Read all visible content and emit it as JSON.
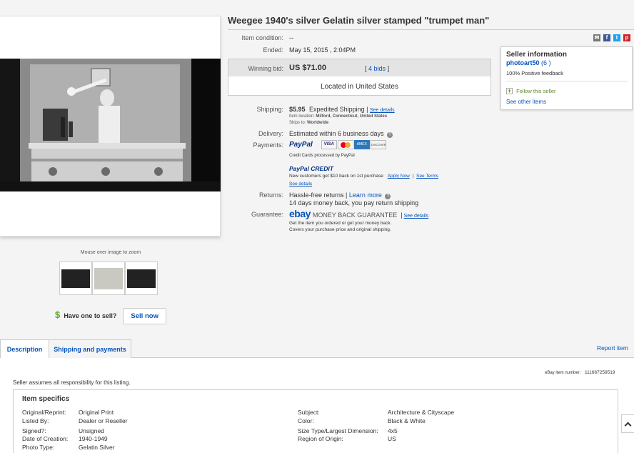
{
  "title": "Weegee 1940's silver Gelatin silver stamped \"trumpet man\"",
  "item": {
    "condition_label": "Item condition:",
    "condition_value": "--",
    "ended_label": "Ended:",
    "ended_value": "May 15, 2015 , 2:04PM",
    "winning_bid_label": "Winning bid:",
    "winning_bid_value": "US $71.00",
    "bids_open": "[",
    "bids_link": "4 bids",
    "bids_close": "]",
    "location": "Located in United States"
  },
  "image": {
    "zoom_hint": "Mouse over image to zoom"
  },
  "sell": {
    "dollar": "$",
    "prompt": "Have one to sell?",
    "button": "Sell now"
  },
  "shipping": {
    "label": "Shipping:",
    "cost": "$5.95",
    "method": "Expedited Shipping",
    "sep": "|",
    "details_link": "See details",
    "location_label": "Item location:",
    "location_value": "Milford, Connecticut, United States",
    "ships_to_label": "Ships to:",
    "ships_to_value": "Worldwide"
  },
  "delivery": {
    "label": "Delivery:",
    "value": "Estimated within 6 business days"
  },
  "payments": {
    "label": "Payments:",
    "paypal": "PayPal",
    "visa": "VISA",
    "amex": "AMEX",
    "discover": "DISCOVER",
    "cc_note": "Credit Cards processed by PayPal",
    "credit_logo": "PayPal CREDIT",
    "credit_offer": "New customers get $10 back on 1st purchase",
    "apply_link": "Apply Now",
    "sep": "|",
    "terms_link": "See Terms",
    "details_link": "See details"
  },
  "returns": {
    "label": "Returns:",
    "value": "Hassle-free returns",
    "sep": "|",
    "learn_link": "Learn more",
    "detail": "14 days money back, you pay return shipping"
  },
  "guarantee": {
    "label": "Guarantee:",
    "ebay_logo": "ebay",
    "mbg": "MONEY BACK GUARANTEE",
    "sep": "|",
    "details_link": "See details",
    "line1": "Get the item you ordered or get your money back.",
    "line2": "Covers your purchase price and original shipping."
  },
  "seller": {
    "heading": "Seller information",
    "name": "photoart50",
    "score": "(6 )",
    "feedback": "100% Positive feedback",
    "follow": "Follow this seller",
    "other_items": "See other items"
  },
  "social_icons": [
    "email-icon",
    "facebook-icon",
    "twitter-icon",
    "pinterest-icon"
  ],
  "tabs": {
    "description": "Description",
    "shipping": "Shipping and payments"
  },
  "report_item": "Report item",
  "item_number_label": "eBay item number:",
  "item_number": "111667259519",
  "responsibility": "Seller assumes all responsibility for this listing.",
  "specifics": {
    "heading": "Item specifics",
    "left": [
      {
        "k": "Original/Reprint:",
        "v": "Original Print"
      },
      {
        "k": "Listed By:",
        "v": "Dealer or Reseller"
      },
      {
        "k": "Signed?:",
        "v": "Unsigned"
      },
      {
        "k": "Date of Creation:",
        "v": "1940-1949"
      },
      {
        "k": "Photo Type:",
        "v": "Gelatin Silver"
      }
    ],
    "right": [
      {
        "k": "Subject:",
        "v": "Architecture & Cityscape"
      },
      {
        "k": "Color:",
        "v": "Black & White"
      },
      {
        "k": "Size Type/Largest Dimension:",
        "v": "4x5"
      },
      {
        "k": "Region of Origin:",
        "v": "US"
      }
    ]
  },
  "colors": {
    "link": "#0654ba",
    "paypal_blue": "#003087",
    "follow_green": "#5ba829"
  }
}
